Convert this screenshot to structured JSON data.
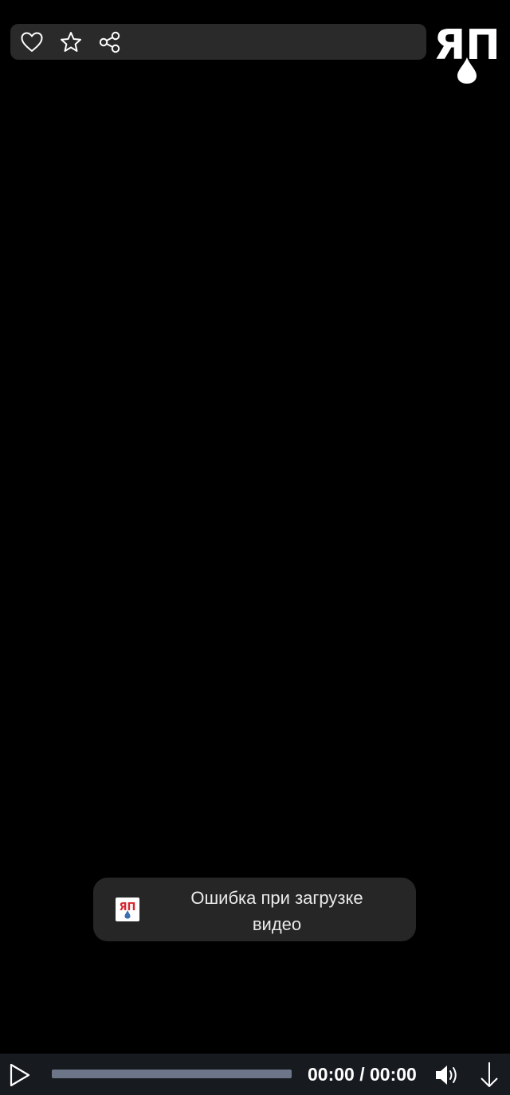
{
  "toolbar": {
    "icons": [
      "heart-icon",
      "star-icon",
      "share-icon"
    ]
  },
  "logo": {
    "text": "ЯП",
    "icon": "drop-icon"
  },
  "toast": {
    "message": "Ошибка при загрузке видео",
    "icon": "app-logo-icon"
  },
  "player": {
    "time": "00:00 / 00:00",
    "progress": 0,
    "icons": [
      "play-icon",
      "volume-icon",
      "download-icon"
    ]
  },
  "colors": {
    "background": "#000000",
    "toolbar": "#2a2a2a",
    "toast": "#262626",
    "controls": "#171a1f",
    "progress_track": "#6c7688",
    "logo_red": "#d8262f",
    "logo_blue": "#3a6fb0"
  }
}
